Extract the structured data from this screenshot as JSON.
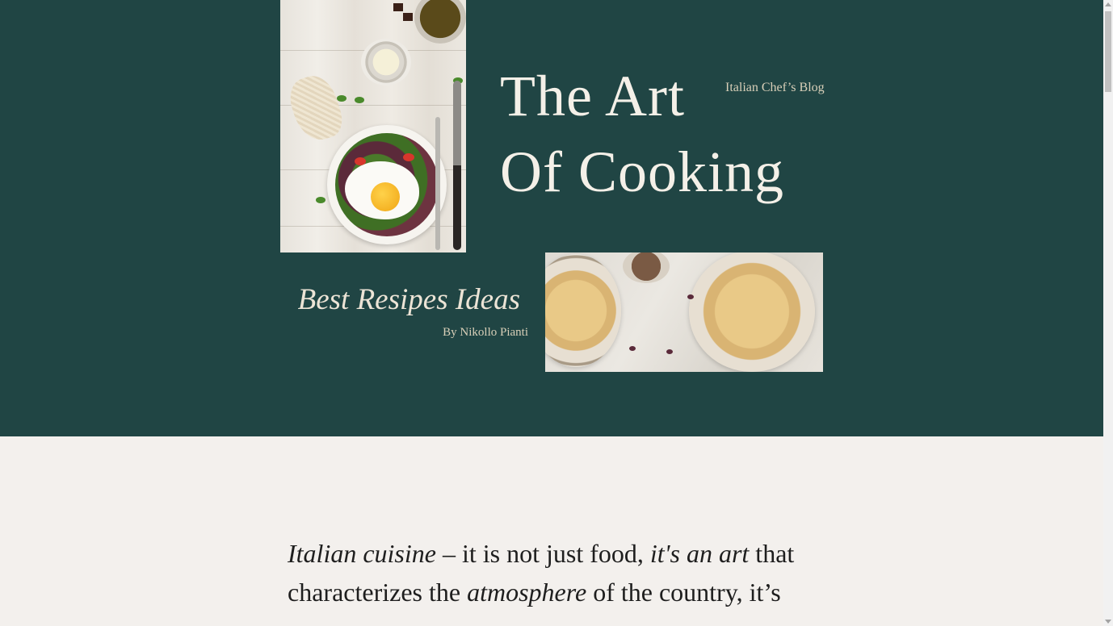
{
  "header": {
    "title_line1": "The Art",
    "title_line2": "Of Cooking",
    "subtitle": "Italian Chef’s Blog",
    "tagline": "Best Resipes Ideas",
    "byline": "By Nikollo Pianti"
  },
  "images": {
    "salad_photo": "salad-with-fried-egg-photo",
    "pasta_photo": "two-plates-of-pasta-photo"
  },
  "intro": {
    "part1": "Italian cuisine",
    "part2": " – it is not just food, ",
    "part3": "it's an art",
    "part4": " that characterizes the ",
    "part5": "atmosphere",
    "part6": " of the country, it’s"
  },
  "colors": {
    "hero_background": "#204544",
    "page_background": "#f3f0ed",
    "title_text": "#f4f0e8",
    "muted_text": "#d8cfb8"
  }
}
